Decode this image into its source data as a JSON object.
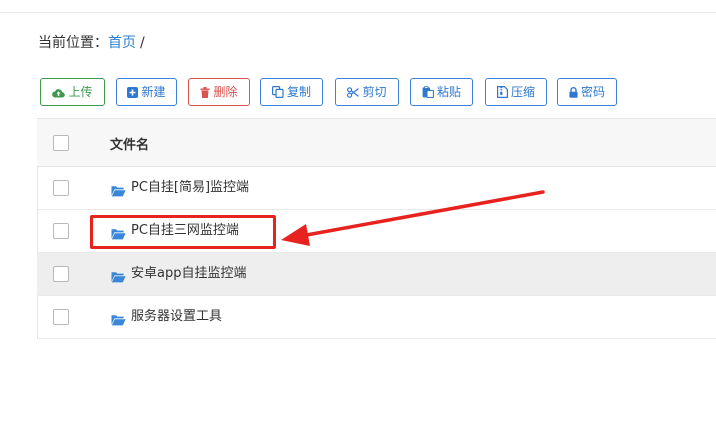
{
  "breadcrumb": {
    "prefix": "当前位置：",
    "home": "首页",
    "separator": "/"
  },
  "toolbar": {
    "buttons": [
      {
        "id": "upload",
        "label": "上传",
        "icon": "cloud-upload-icon",
        "color": "#3d9a4e"
      },
      {
        "id": "new",
        "label": "新建",
        "icon": "plus-square-icon",
        "color": "#2f78cf"
      },
      {
        "id": "delete",
        "label": "删除",
        "icon": "trash-icon",
        "color": "#d9534f"
      },
      {
        "id": "copy",
        "label": "复制",
        "icon": "copy-icon",
        "color": "#2f78cf"
      },
      {
        "id": "cut",
        "label": "剪切",
        "icon": "scissors-icon",
        "color": "#2f78cf"
      },
      {
        "id": "paste",
        "label": "粘贴",
        "icon": "paste-icon",
        "color": "#2f78cf"
      },
      {
        "id": "compress",
        "label": "压缩",
        "icon": "archive-icon",
        "color": "#2f78cf"
      },
      {
        "id": "password",
        "label": "密码",
        "icon": "lock-icon",
        "color": "#2f78cf"
      }
    ]
  },
  "table": {
    "header": "文件名",
    "rows": [
      {
        "name": "PC自挂[简易]监控端",
        "icon": "folder-open-icon"
      },
      {
        "name": "PC自挂三网监控端",
        "icon": "folder-open-icon",
        "highlighted": true
      },
      {
        "name": "安卓app自挂监控端",
        "icon": "folder-open-icon",
        "hovered": true
      },
      {
        "name": "服务器设置工具",
        "icon": "folder-open-icon"
      }
    ]
  },
  "colors": {
    "link": "#2d7fd4",
    "annotation": "#e8231f",
    "folder": "#3a86d8"
  }
}
